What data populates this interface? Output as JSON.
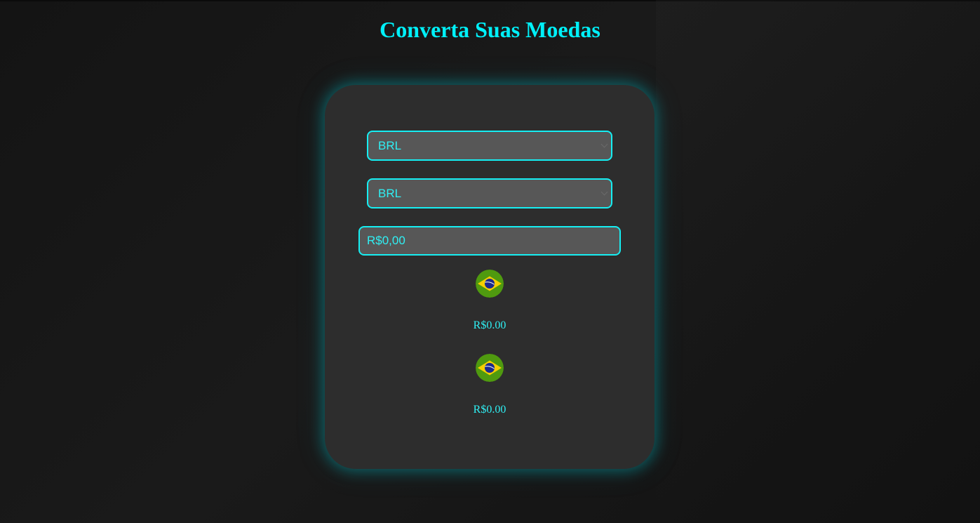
{
  "header": {
    "title": "Converta Suas Moedas"
  },
  "converter": {
    "from_currency": {
      "selected": "BRL"
    },
    "to_currency": {
      "selected": "BRL"
    },
    "amount": {
      "value": "R$0,00"
    },
    "result_from": {
      "flag_icon": "brazil-flag-icon",
      "value": "R$0.00"
    },
    "result_to": {
      "flag_icon": "brazil-flag-icon",
      "value": "R$0.00"
    }
  },
  "colors": {
    "accent": "#00f0f8",
    "card_background": "#2d2d2d",
    "field_background": "#575757",
    "page_background": "#151515"
  }
}
